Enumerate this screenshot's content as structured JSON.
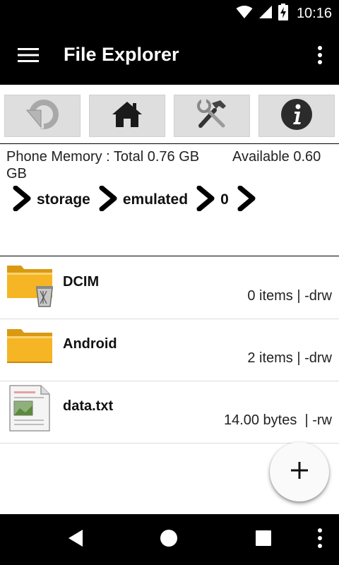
{
  "status_bar": {
    "time": "10:16",
    "icons": [
      "wifi-icon",
      "cell-signal-icon",
      "battery-charging-icon"
    ]
  },
  "app_bar": {
    "title": "File Explorer",
    "menu_icon": "hamburger-menu-icon",
    "overflow_icon": "more-vert-icon"
  },
  "toolbar": {
    "buttons": [
      {
        "name": "back",
        "icon": "back-arrow-icon"
      },
      {
        "name": "home",
        "icon": "home-icon"
      },
      {
        "name": "tools",
        "icon": "tools-icon"
      },
      {
        "name": "info",
        "icon": "info-icon"
      }
    ]
  },
  "storage": {
    "total_text": "Phone Memory : Total 0.76 GB",
    "available_text": "Available 0.60",
    "unit_text": "GB"
  },
  "breadcrumb": [
    "storage",
    "emulated",
    "0"
  ],
  "files": [
    {
      "name": "DCIM",
      "meta": "0 items | -drw",
      "icon": "folder-trash-icon"
    },
    {
      "name": "Android",
      "meta": "2 items | -drw",
      "icon": "folder-icon"
    },
    {
      "name": "data.txt",
      "meta": "14.00 bytes  | -rw",
      "icon": "text-file-icon"
    }
  ],
  "fab": {
    "icon": "plus-icon"
  },
  "nav_bar": {
    "icons": [
      "nav-back-icon",
      "nav-home-icon",
      "nav-recents-icon",
      "nav-more-icon"
    ]
  },
  "colors": {
    "bar": "#000000",
    "tool_button": "#dedede",
    "folder": "#f5b524"
  }
}
